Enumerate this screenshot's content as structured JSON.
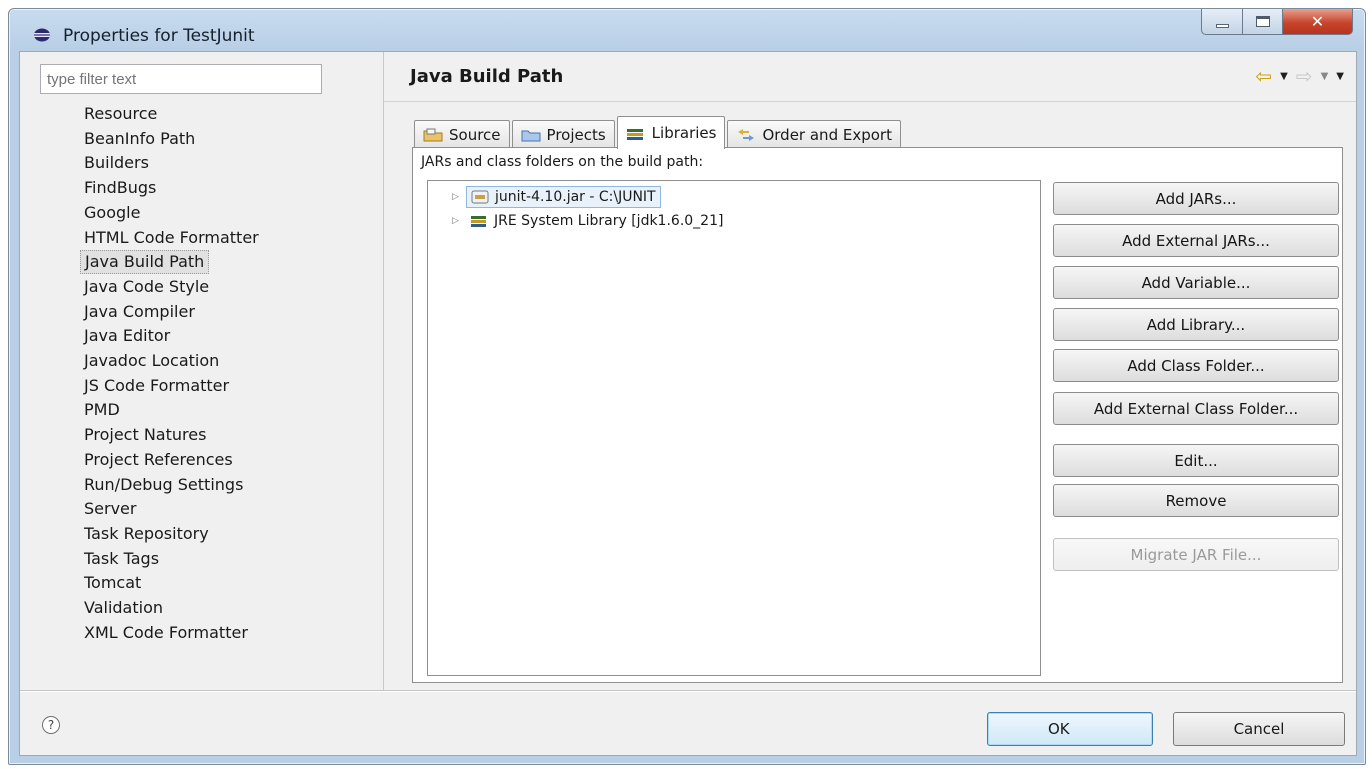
{
  "window": {
    "title": "Properties for TestJunit",
    "title_icon": "eclipse-icon",
    "controls": [
      "minimize-icon",
      "maximize-icon",
      "close-icon"
    ]
  },
  "filter": {
    "placeholder": "type filter text"
  },
  "nav": {
    "items": [
      "Resource",
      "BeanInfo Path",
      "Builders",
      "FindBugs",
      "Google",
      "HTML Code Formatter",
      "Java Build Path",
      "Java Code Style",
      "Java Compiler",
      "Java Editor",
      "Javadoc Location",
      "JS Code Formatter",
      "PMD",
      "Project Natures",
      "Project References",
      "Run/Debug Settings",
      "Server",
      "Task Repository",
      "Task Tags",
      "Tomcat",
      "Validation",
      "XML Code Formatter"
    ],
    "selected": "Java Build Path"
  },
  "page": {
    "title": "Java Build Path",
    "nav_icons": [
      "back-arrow-icon",
      "dropdown-icon",
      "forward-arrow-icon",
      "dropdown-icon",
      "menu-dropdown-icon"
    ]
  },
  "tabs": [
    {
      "label": "Source",
      "icon": "source-folder-icon"
    },
    {
      "label": "Projects",
      "icon": "project-icon"
    },
    {
      "label": "Libraries",
      "icon": "library-icon",
      "active": true
    },
    {
      "label": "Order and Export",
      "icon": "order-export-icon"
    }
  ],
  "libraries": {
    "label": "JARs and class folders on the build path:",
    "entries": [
      {
        "label": "junit-4.10.jar - C:\\JUNIT",
        "icon": "jar-icon",
        "selected": true
      },
      {
        "label": "JRE System Library [jdk1.6.0_21]",
        "icon": "library-icon"
      }
    ],
    "buttons": [
      {
        "label": "Add JARs...",
        "enabled": true
      },
      {
        "label": "Add External JARs...",
        "enabled": true
      },
      {
        "label": "Add Variable...",
        "enabled": true
      },
      {
        "label": "Add Library...",
        "enabled": true
      },
      {
        "label": "Add Class Folder...",
        "enabled": true
      },
      {
        "label": "Add External Class Folder...",
        "enabled": true
      },
      {
        "label": "Edit...",
        "enabled": true
      },
      {
        "label": "Remove",
        "enabled": true
      },
      {
        "label": "Migrate JAR File...",
        "enabled": false
      }
    ]
  },
  "footer": {
    "help_label": "?",
    "ok_label": "OK",
    "cancel_label": "Cancel"
  },
  "colors": {
    "titlebar": "#b9cfe6",
    "dialog_bg": "#f0f0f0",
    "ok_accent": "#3c7fb1",
    "back_arrow": "#c9a21a"
  }
}
